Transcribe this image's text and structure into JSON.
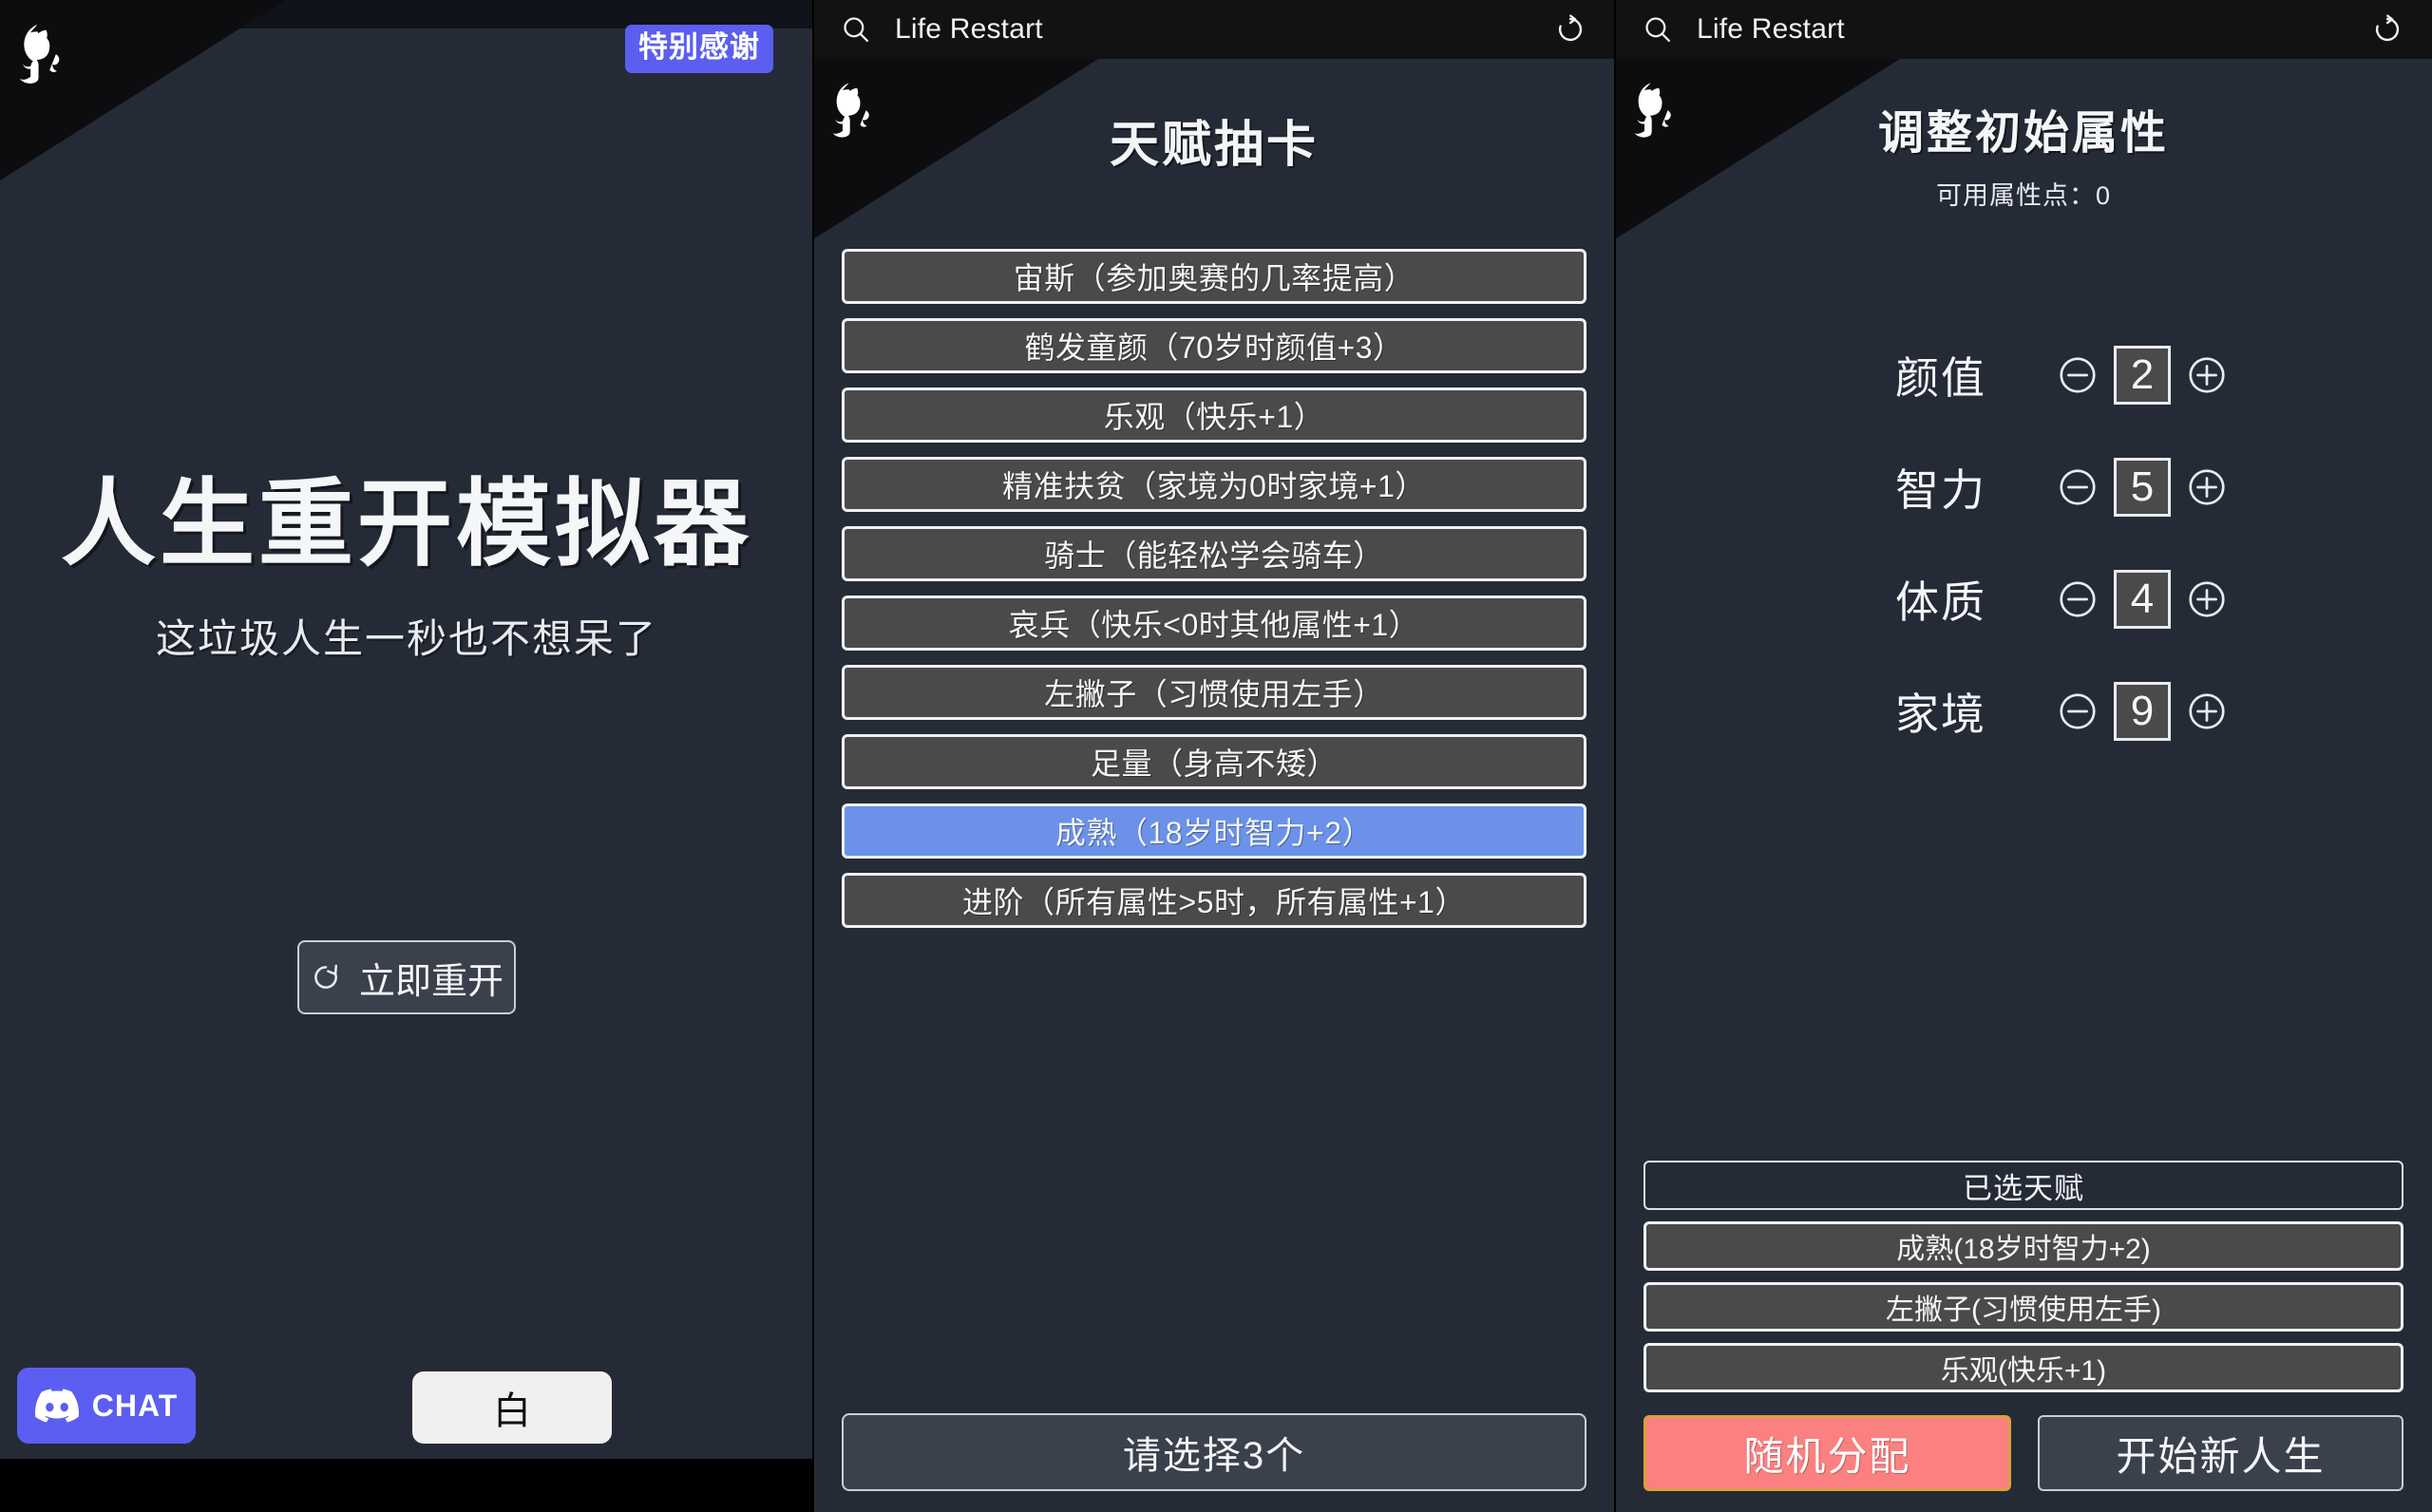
{
  "left_panel": {
    "thanks_badge": "特别感谢",
    "hero_title": "人生重开模拟器",
    "hero_subtitle": "这垃圾人生一秒也不想呆了",
    "restart_button": "立即重开",
    "restart_icon": "refresh-circle-icon",
    "discord_button": "CHAT",
    "discord_icon": "discord-icon",
    "white_button": "白",
    "corner_icon": "github-octocat-icon"
  },
  "middle_panel": {
    "browser": {
      "search_icon": "search-icon",
      "title": "Life Restart",
      "reload_icon": "reload-icon"
    },
    "corner_icon": "github-octocat-icon",
    "page_title": "天赋抽卡",
    "talents": [
      {
        "label": "宙斯（参加奥赛的几率提高）",
        "selected": false
      },
      {
        "label": "鹤发童颜（70岁时颜值+3）",
        "selected": false
      },
      {
        "label": "乐观（快乐+1）",
        "selected": false
      },
      {
        "label": "精准扶贫（家境为0时家境+1）",
        "selected": false
      },
      {
        "label": "骑士（能轻松学会骑车）",
        "selected": false
      },
      {
        "label": "哀兵（快乐<0时其他属性+1）",
        "selected": false
      },
      {
        "label": "左撇子（习惯使用左手）",
        "selected": false
      },
      {
        "label": "足量（身高不矮）",
        "selected": false
      },
      {
        "label": "成熟（18岁时智力+2）",
        "selected": true
      },
      {
        "label": "进阶（所有属性>5时，所有属性+1）",
        "selected": false
      }
    ],
    "bottom_button": "请选择3个"
  },
  "right_panel": {
    "browser": {
      "search_icon": "search-icon",
      "title": "Life Restart",
      "reload_icon": "reload-icon"
    },
    "corner_icon": "github-octocat-icon",
    "page_title": "调整初始属性",
    "points_label": "可用属性点：0",
    "attributes": [
      {
        "name": "颜值",
        "value": "2",
        "minus_icon": "minus-circle-icon",
        "plus_icon": "plus-circle-icon"
      },
      {
        "name": "智力",
        "value": "5",
        "minus_icon": "minus-circle-icon",
        "plus_icon": "plus-circle-icon"
      },
      {
        "name": "体质",
        "value": "4",
        "minus_icon": "minus-circle-icon",
        "plus_icon": "plus-circle-icon"
      },
      {
        "name": "家境",
        "value": "9",
        "minus_icon": "minus-circle-icon",
        "plus_icon": "plus-circle-icon"
      }
    ],
    "chosen_header": "已选天赋",
    "chosen_talents": [
      "成熟(18岁时智力+2)",
      "左撇子(习惯使用左手)",
      "乐观(快乐+1)"
    ],
    "random_button": "随机分配",
    "start_button": "开始新人生"
  },
  "colors": {
    "panel_bg": "#252b36",
    "card_bg": "#4a4a4a",
    "card_selected": "#6b92e8",
    "accent_blurple": "#5b5ef0",
    "random_btn": "#fb8080",
    "random_btn_border": "#d8a23c",
    "chrome_bg": "#121212"
  }
}
